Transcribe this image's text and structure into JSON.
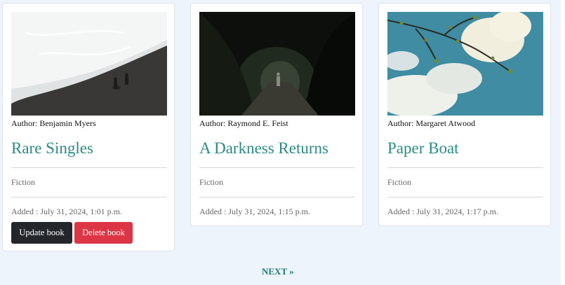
{
  "books": [
    {
      "image_icon": "beach-image",
      "author": "Author: Benjamin Myers",
      "title": "Rare Singles",
      "genre": "Fiction",
      "added": "Added : July 31, 2024, 1:01 p.m.",
      "update_label": "Update book",
      "delete_label": "Delete book"
    },
    {
      "image_icon": "forest-image",
      "author": "Author: Raymond E. Feist",
      "title": "A Darkness Returns",
      "genre": "Fiction",
      "added": "Added : July 31, 2024, 1:15 p.m."
    },
    {
      "image_icon": "sky-branch-image",
      "author": "Author: Margaret Atwood",
      "title": "Paper Boat",
      "genre": "Fiction",
      "added": "Added : July 31, 2024, 1:17 p.m."
    }
  ],
  "pagination": {
    "next_label": "NEXT »"
  },
  "colors": {
    "title": "#2a8b82",
    "update_button": "#23272b",
    "delete_button": "#dc3545",
    "page_background": "#eef4fb"
  }
}
